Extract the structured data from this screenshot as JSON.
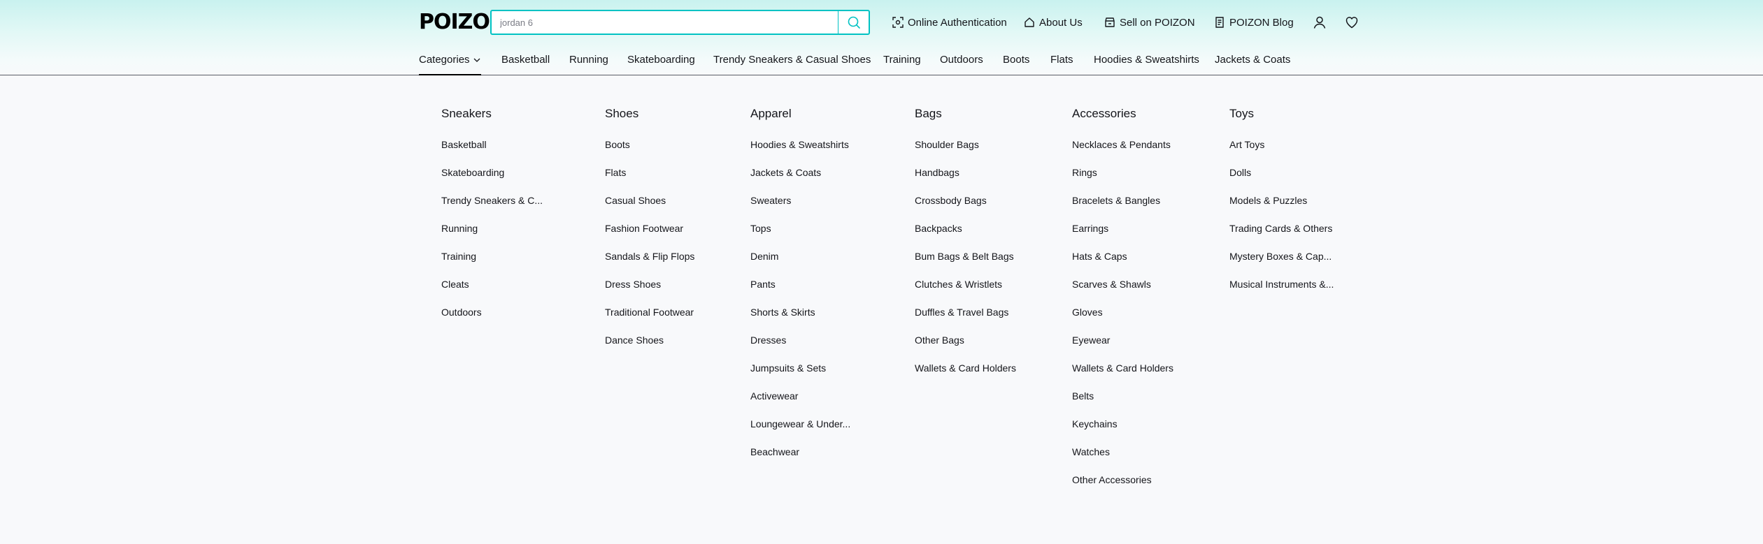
{
  "brand": {
    "logo": "POIZON"
  },
  "search": {
    "value": "jordan 6",
    "placeholder": "jordan 6"
  },
  "toplinks": [
    {
      "label": "Online Authentication",
      "icon": "scan-icon"
    },
    {
      "label": "About Us",
      "icon": "home-icon"
    },
    {
      "label": "Sell on POIZON",
      "icon": "shop-icon"
    },
    {
      "label": "POIZON Blog",
      "icon": "document-icon"
    }
  ],
  "nav": [
    "Categories",
    "Basketball",
    "Running",
    "Skateboarding",
    "Trendy Sneakers & Casual Shoes",
    "Training",
    "Outdoors",
    "Boots",
    "Flats",
    "Hoodies & Sweatshirts",
    "Jackets & Coats"
  ],
  "menu": [
    {
      "title": "Sneakers",
      "items": [
        "Basketball",
        "Skateboarding",
        "Trendy Sneakers & C...",
        "Running",
        "Training",
        "Cleats",
        "Outdoors"
      ]
    },
    {
      "title": "Shoes",
      "items": [
        "Boots",
        "Flats",
        "Casual Shoes",
        "Fashion Footwear",
        "Sandals & Flip Flops",
        "Dress Shoes",
        "Traditional Footwear",
        "Dance Shoes"
      ]
    },
    {
      "title": "Apparel",
      "items": [
        "Hoodies & Sweatshirts",
        "Jackets & Coats",
        "Sweaters",
        "Tops",
        "Denim",
        "Pants",
        "Shorts & Skirts",
        "Dresses",
        "Jumpsuits & Sets",
        "Activewear",
        "Loungewear & Under...",
        "Beachwear"
      ]
    },
    {
      "title": "Bags",
      "items": [
        "Shoulder Bags",
        "Handbags",
        "Crossbody Bags",
        "Backpacks",
        "Bum Bags & Belt Bags",
        "Clutches & Wristlets",
        "Duffles & Travel Bags",
        "Other Bags",
        "Wallets & Card Holders"
      ]
    },
    {
      "title": "Accessories",
      "items": [
        "Necklaces & Pendants",
        "Rings",
        "Bracelets & Bangles",
        "Earrings",
        "Hats & Caps",
        "Scarves & Shawls",
        "Gloves",
        "Eyewear",
        "Wallets & Card Holders",
        "Belts",
        "Keychains",
        "Watches",
        "Other Accessories"
      ]
    },
    {
      "title": "Toys",
      "items": [
        "Art Toys",
        "Dolls",
        "Models & Puzzles",
        "Trading Cards & Others",
        "Mystery Boxes & Cap...",
        "Musical Instruments &..."
      ]
    }
  ],
  "colors": {
    "accent": "#01c2c3",
    "text": "#14151a",
    "background": "#f8f9fb"
  }
}
